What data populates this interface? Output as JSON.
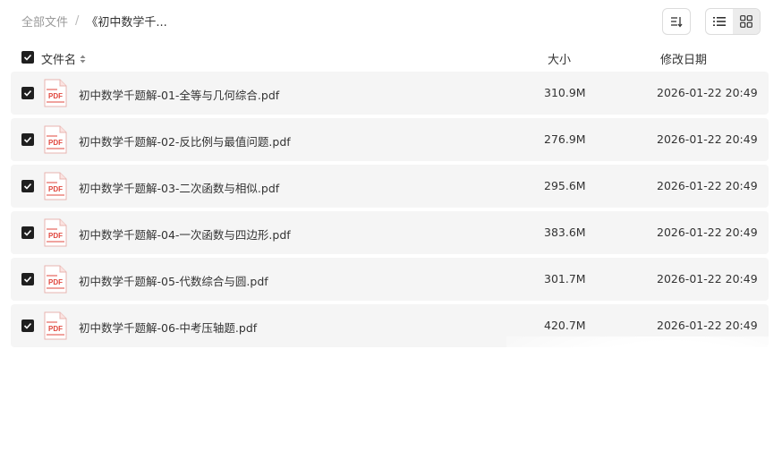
{
  "breadcrumb": {
    "root": "全部文件",
    "separator": "/",
    "current": "《初中数学千..."
  },
  "toolbar": {
    "sort_icon": "sort-icon",
    "list_view_icon": "list-view-icon",
    "grid_view_icon": "grid-view-icon"
  },
  "table": {
    "columns": {
      "name": "文件名",
      "size": "大小",
      "date": "修改日期"
    },
    "files": [
      {
        "name": "初中数学千题解-01-全等与几何综合.pdf",
        "size": "310.9M",
        "date": "2026-01-22 20:49",
        "icon": "PDF"
      },
      {
        "name": "初中数学千题解-02-反比例与最值问题.pdf",
        "size": "276.9M",
        "date": "2026-01-22 20:49",
        "icon": "PDF"
      },
      {
        "name": "初中数学千题解-03-二次函数与相似.pdf",
        "size": "295.6M",
        "date": "2026-01-22 20:49",
        "icon": "PDF"
      },
      {
        "name": "初中数学千题解-04-一次函数与四边形.pdf",
        "size": "383.6M",
        "date": "2026-01-22 20:49",
        "icon": "PDF"
      },
      {
        "name": "初中数学千题解-05-代数综合与圆.pdf",
        "size": "301.7M",
        "date": "2026-01-22 20:49",
        "icon": "PDF"
      },
      {
        "name": "初中数学千题解-06-中考压轴题.pdf",
        "size": "420.7M",
        "date": "2026-01-22 20:49",
        "icon": "PDF"
      }
    ]
  },
  "colors": {
    "row_bg": "#f5f5f5",
    "checkbox": "#1f1f1f",
    "pdf_red": "#e0473e"
  }
}
